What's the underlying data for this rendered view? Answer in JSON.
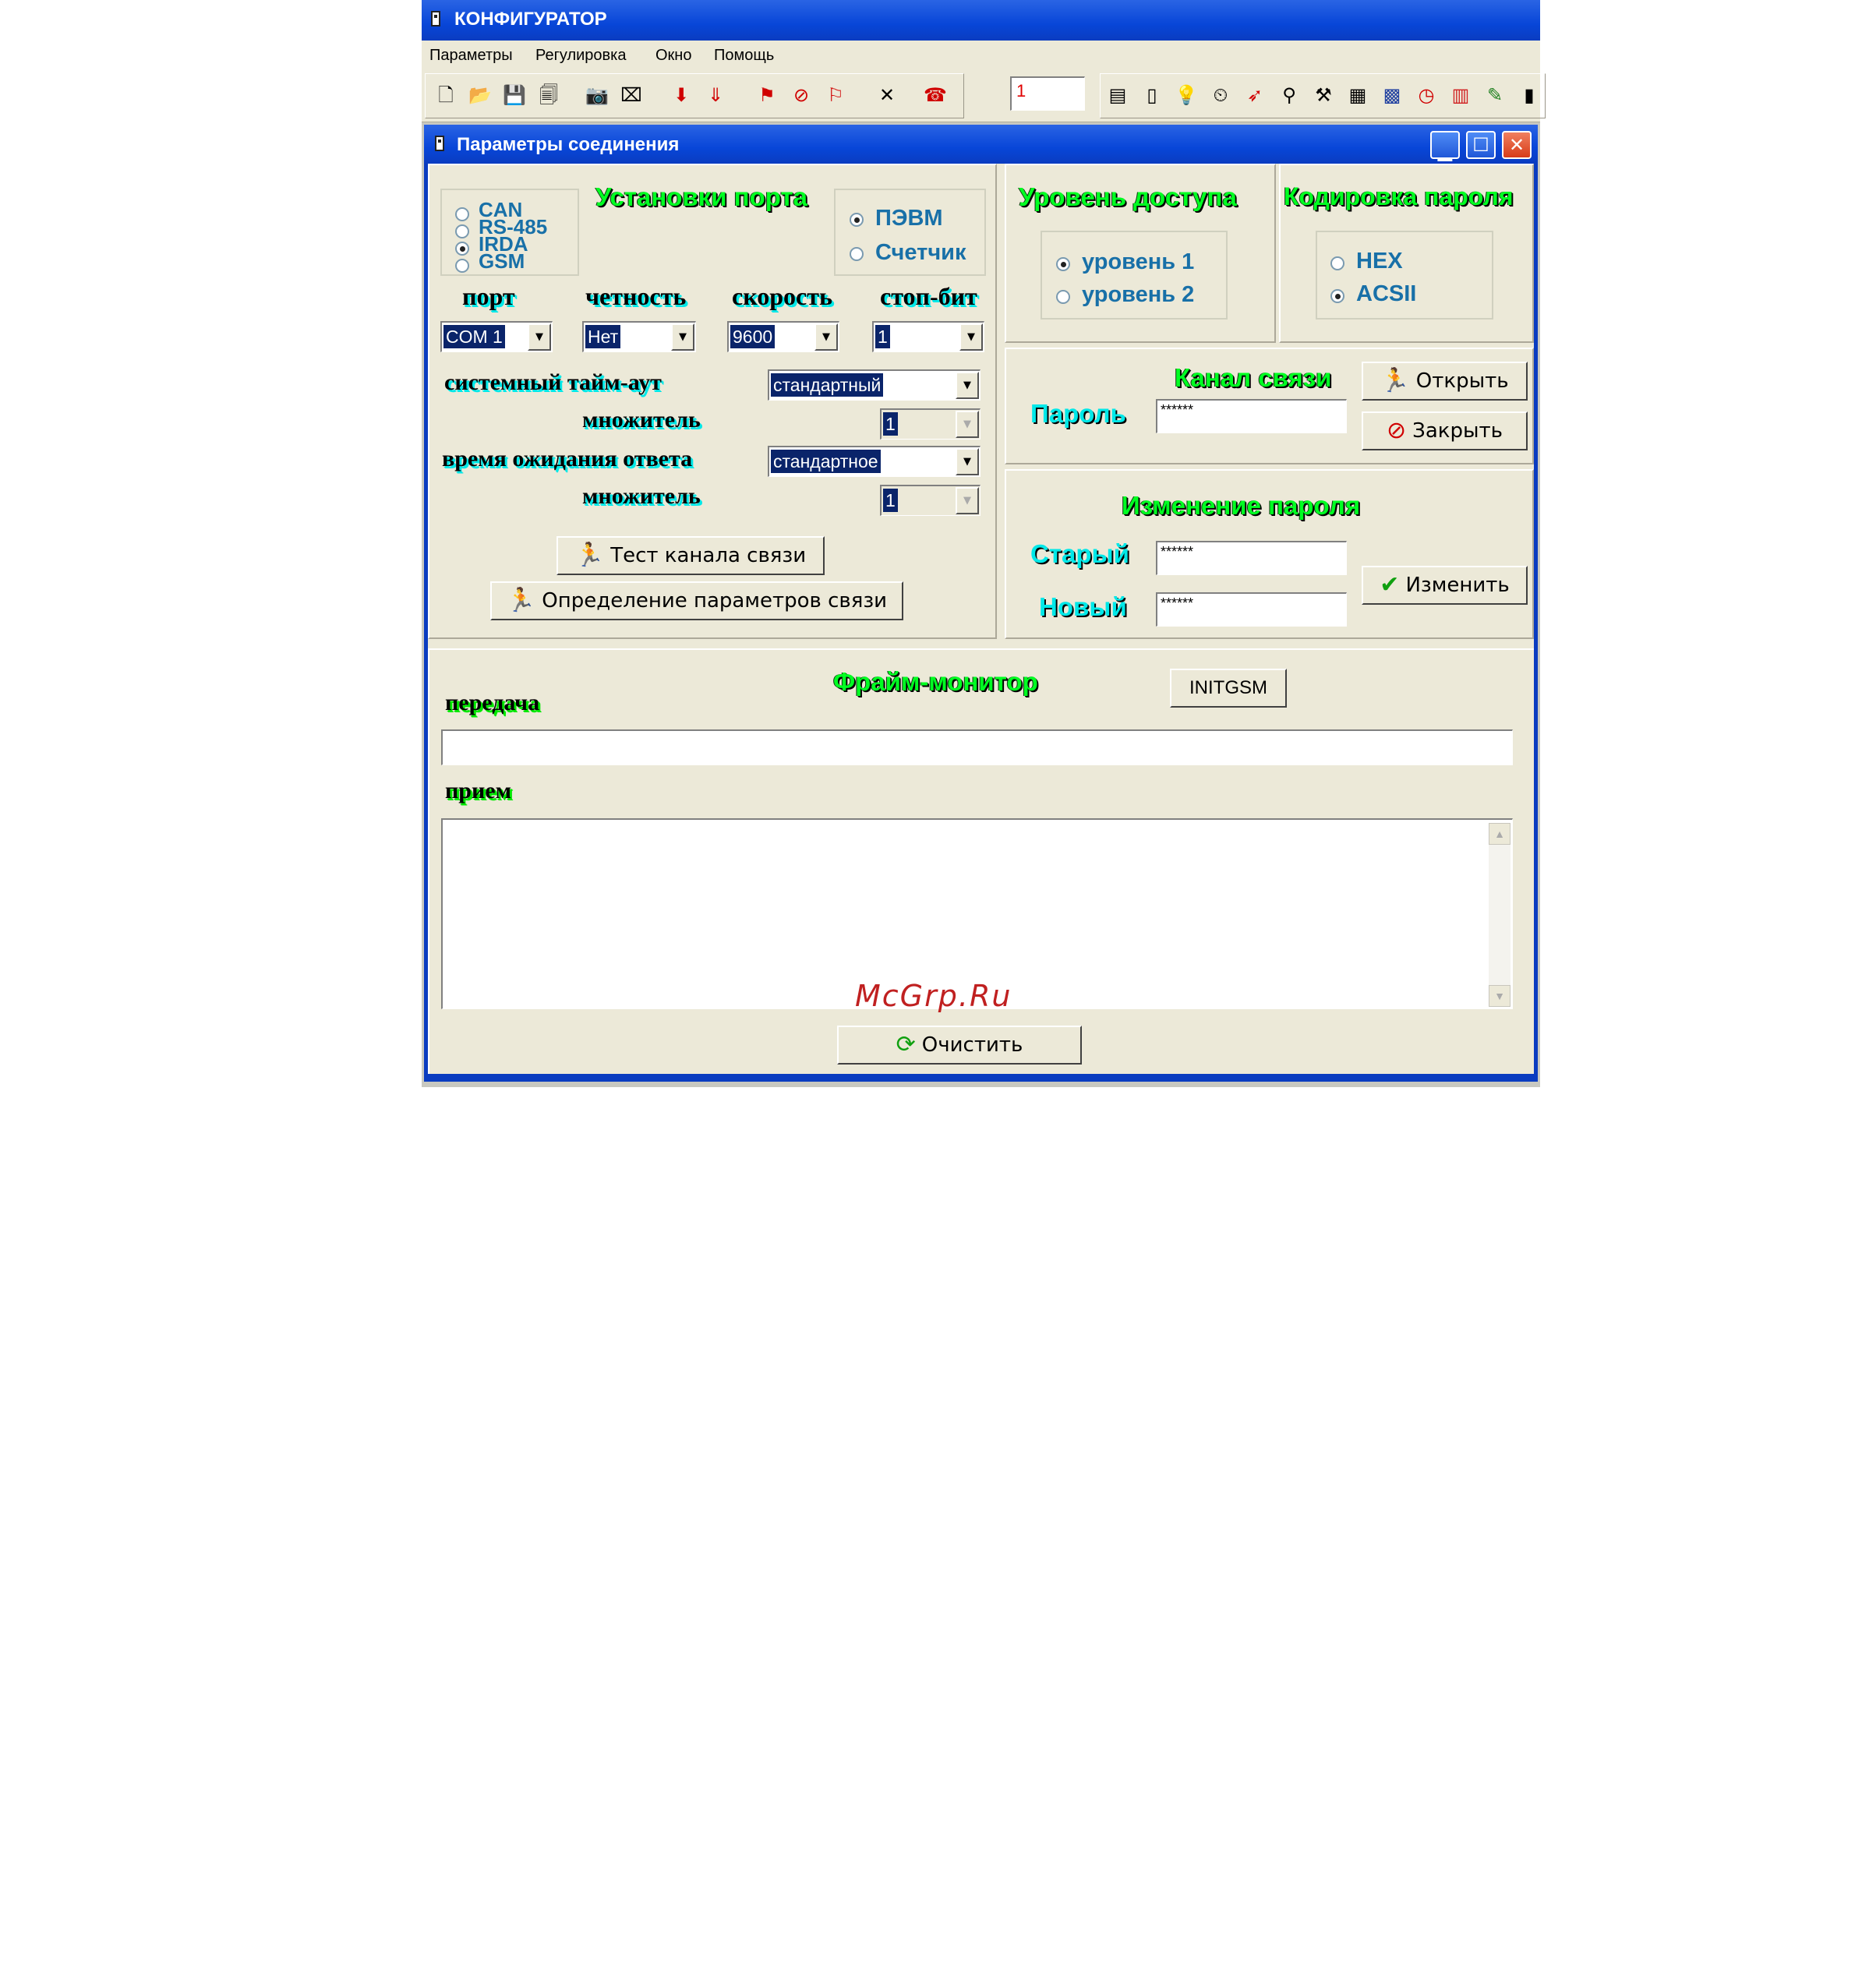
{
  "app": {
    "title": "КОНФИГУРАТОР",
    "menu": [
      "Параметры",
      "Регулировка",
      "Окно",
      "Помощь"
    ],
    "toolbar_input_value": "1"
  },
  "dialog": {
    "title": "Параметры соединения",
    "port_settings": {
      "title": "Установки порта",
      "interfaces": [
        "CAN",
        "RS-485",
        "IRDA",
        "GSM"
      ],
      "interface_selected": "IRDA",
      "device_options": [
        "ПЭВМ",
        "Счетчик"
      ],
      "device_selected": "ПЭВМ",
      "labels": {
        "port": "порт",
        "parity": "четность",
        "speed": "скорость",
        "stopbits": "стоп-бит"
      },
      "values": {
        "port": "COM 1",
        "parity": "Нет",
        "speed": "9600",
        "stopbits": "1"
      },
      "system_timeout_label": "системный тайм-аут",
      "system_timeout_value": "стандартный",
      "multiplier_label": "множитель",
      "multiplier1_value": "1",
      "response_wait_label": "время ожидания ответа",
      "response_wait_value": "стандартное",
      "multiplier2_value": "1",
      "test_button": "Тест канала связи",
      "detect_button": "Определение параметров связи"
    },
    "access_level": {
      "title": "Уровень доступа",
      "options": [
        "уровень 1",
        "уровень 2"
      ],
      "selected": "уровень 1"
    },
    "password_encoding": {
      "title": "Кодировка пароля",
      "options": [
        "HEX",
        "ACSII"
      ],
      "selected": "ACSII"
    },
    "channel": {
      "title": "Канал связи",
      "password_label": "Пароль",
      "password_value": "******",
      "open_button": "Открыть",
      "close_button": "Закрыть"
    },
    "change_password": {
      "title": "Изменение пароля",
      "old_label": "Старый",
      "old_value": "******",
      "new_label": "Новый",
      "new_value": "******",
      "change_button": "Изменить"
    },
    "frame_monitor": {
      "title": "Фрайм-монитор",
      "initgsm_button": "INITGSM",
      "send_label": "передача",
      "send_value": "",
      "receive_label": "прием",
      "receive_value": "",
      "clear_button": "Очистить"
    }
  },
  "watermark": "McGrp.Ru"
}
